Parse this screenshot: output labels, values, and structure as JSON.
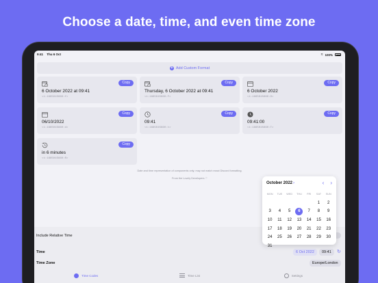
{
  "headline": "Choose a date, time, and even time zone",
  "status": {
    "time": "9:41",
    "date": "Thu 6 Oct",
    "battery": "100%"
  },
  "add_format_label": "Add Custom Format",
  "cards": [
    {
      "icon": "calendar-clock-icon",
      "value": "6 October 2022 at 09:41",
      "code": "<t:1665045660:f>",
      "copy": "Copy"
    },
    {
      "icon": "calendar-clock-icon",
      "value": "Thursday, 6 October 2022 at 09:41",
      "code": "<t:1665045660:F>",
      "copy": "Copy"
    },
    {
      "icon": "calendar-icon",
      "value": "6 October 2022",
      "code": "<t:1665045660:D>",
      "copy": "Copy"
    },
    {
      "icon": "calendar-icon",
      "value": "06/10/2022",
      "code": "<t:1665045660:d>",
      "copy": "Copy"
    },
    {
      "icon": "clock-icon",
      "value": "09:41",
      "code": "<t:1665045660:t>",
      "copy": "Copy"
    },
    {
      "icon": "clock-filled-icon",
      "value": "09:41:00",
      "code": "<t:1665045660:T>",
      "copy": "Copy"
    },
    {
      "icon": "relative-time-icon",
      "value": "in 6 minutes",
      "code": "<t:1665045660:R>",
      "copy": "Copy"
    }
  ],
  "disclaimer": "Date and time representation of components only; may not match exact Discord formatting.",
  "credit": "From the Lovely Developers",
  "calendar": {
    "month_label": "October 2022",
    "days_of_week": [
      "MON",
      "TUE",
      "WED",
      "THU",
      "FRI",
      "SAT",
      "SUN"
    ],
    "weeks": [
      [
        "",
        "",
        "",
        "",
        "",
        "1",
        "2"
      ],
      [
        "3",
        "4",
        "5",
        "6",
        "7",
        "8",
        "9"
      ],
      [
        "10",
        "11",
        "12",
        "13",
        "14",
        "15",
        "16"
      ],
      [
        "17",
        "18",
        "19",
        "20",
        "21",
        "22",
        "23"
      ],
      [
        "24",
        "25",
        "26",
        "27",
        "28",
        "29",
        "30"
      ],
      [
        "31",
        "",
        "",
        "",
        "",
        "",
        ""
      ]
    ],
    "selected_day": "6"
  },
  "settings": {
    "relative_label": "Include Relative Time",
    "time_label": "Time",
    "date_value": "6 Oct 2022",
    "time_value": "09:41",
    "zone_label": "Time Zone",
    "zone_value": "Europe/London"
  },
  "tabs": [
    {
      "label": "Time Codes",
      "active": true
    },
    {
      "label": "Time List",
      "active": false
    },
    {
      "label": "Settings",
      "active": false
    }
  ],
  "accent_color": "#6d6cf2",
  "background_color": "#6d6cf2"
}
